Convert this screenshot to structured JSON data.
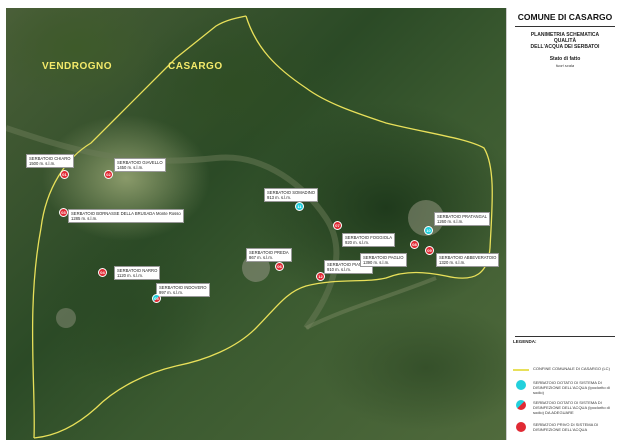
{
  "title": "COMUNE DI CASARGO",
  "subtitle_lines": [
    "PLANIMETRIA SCHEMATICA",
    "QUALITÀ",
    "DELL'ACQUA DEI SERBATOI"
  ],
  "stato": "Stato di fatto",
  "scala": "fuori scala",
  "places": {
    "vendrogno": "VENDROGNO",
    "casargo": "CASARGO"
  },
  "colors": {
    "boundary": "#e8e05a",
    "red": "#e02a34",
    "cyan": "#22d0dc"
  },
  "serbatoi": [
    {
      "num": "01",
      "type": "red",
      "name": "SERBATOIO CHIARO",
      "alt": "1500 m. s.l.m."
    },
    {
      "num": "02",
      "type": "red",
      "name": "SERBATOIO GIAVELLO",
      "alt": "1450 m. s.l.m."
    },
    {
      "num": "03",
      "type": "red",
      "name": "SERBATOIO BORNASSE DELLA BRUSADA  Monte Rosso",
      "alt": "1285 m. s.l.m."
    },
    {
      "num": "04",
      "type": "red",
      "name": "SERBATOIO NARRO",
      "alt": "1120 m. s.l.m."
    },
    {
      "num": "05",
      "type": "mixed",
      "name": "SERBATOIO INDOVERO",
      "alt": "997 m. s.l.m."
    },
    {
      "num": "06",
      "type": "red",
      "name": "SERBATOIO PREDA",
      "alt": "867 m. s.l.m."
    },
    {
      "num": "07",
      "type": "red",
      "name": "SERBATOIO FOGGIOLA",
      "alt": "920 m. s.l.m."
    },
    {
      "num": "08",
      "type": "red",
      "name": "SERBATOIO PAGLIO",
      "alt": "1390 m. s.l.m."
    },
    {
      "num": "09",
      "type": "red",
      "name": "SERBATOIO ABBEVERATOIO",
      "alt": "1320 m. s.l.m."
    },
    {
      "num": "10",
      "type": "cyan",
      "name": "SERBATOIO PRATANGAL",
      "alt": "1260 m. s.l.m."
    },
    {
      "num": "11",
      "type": "cyan",
      "name": "SERBATOIO SOMADINO",
      "alt": "913 m. s.l.m."
    },
    {
      "num": "12",
      "type": "red",
      "name": "SERBATOIO PIANGAL",
      "alt": "910 m. s.l.m."
    }
  ],
  "legend": {
    "title": "LEGENDA:",
    "items": [
      {
        "kind": "line",
        "text": "CONFINE COMUNALE DI CASARGO (LC)"
      },
      {
        "kind": "cyan",
        "text": "SERBATOIO DOTATO DI SISTEMA DI DISINFEZIONE DELL'ACQUA (Ipoclorito di sodio)"
      },
      {
        "kind": "mixed",
        "text": "SERBATOIO DOTATO DI SISTEMA DI DISINFEZIONE DELL'ACQUA (Ipoclorito di sodio) DA ADEGUARE"
      },
      {
        "kind": "red",
        "text": "SERBATOIO PRIVO DI SISTEMA DI DISINFEZIONE DELL'ACQUA"
      }
    ]
  }
}
